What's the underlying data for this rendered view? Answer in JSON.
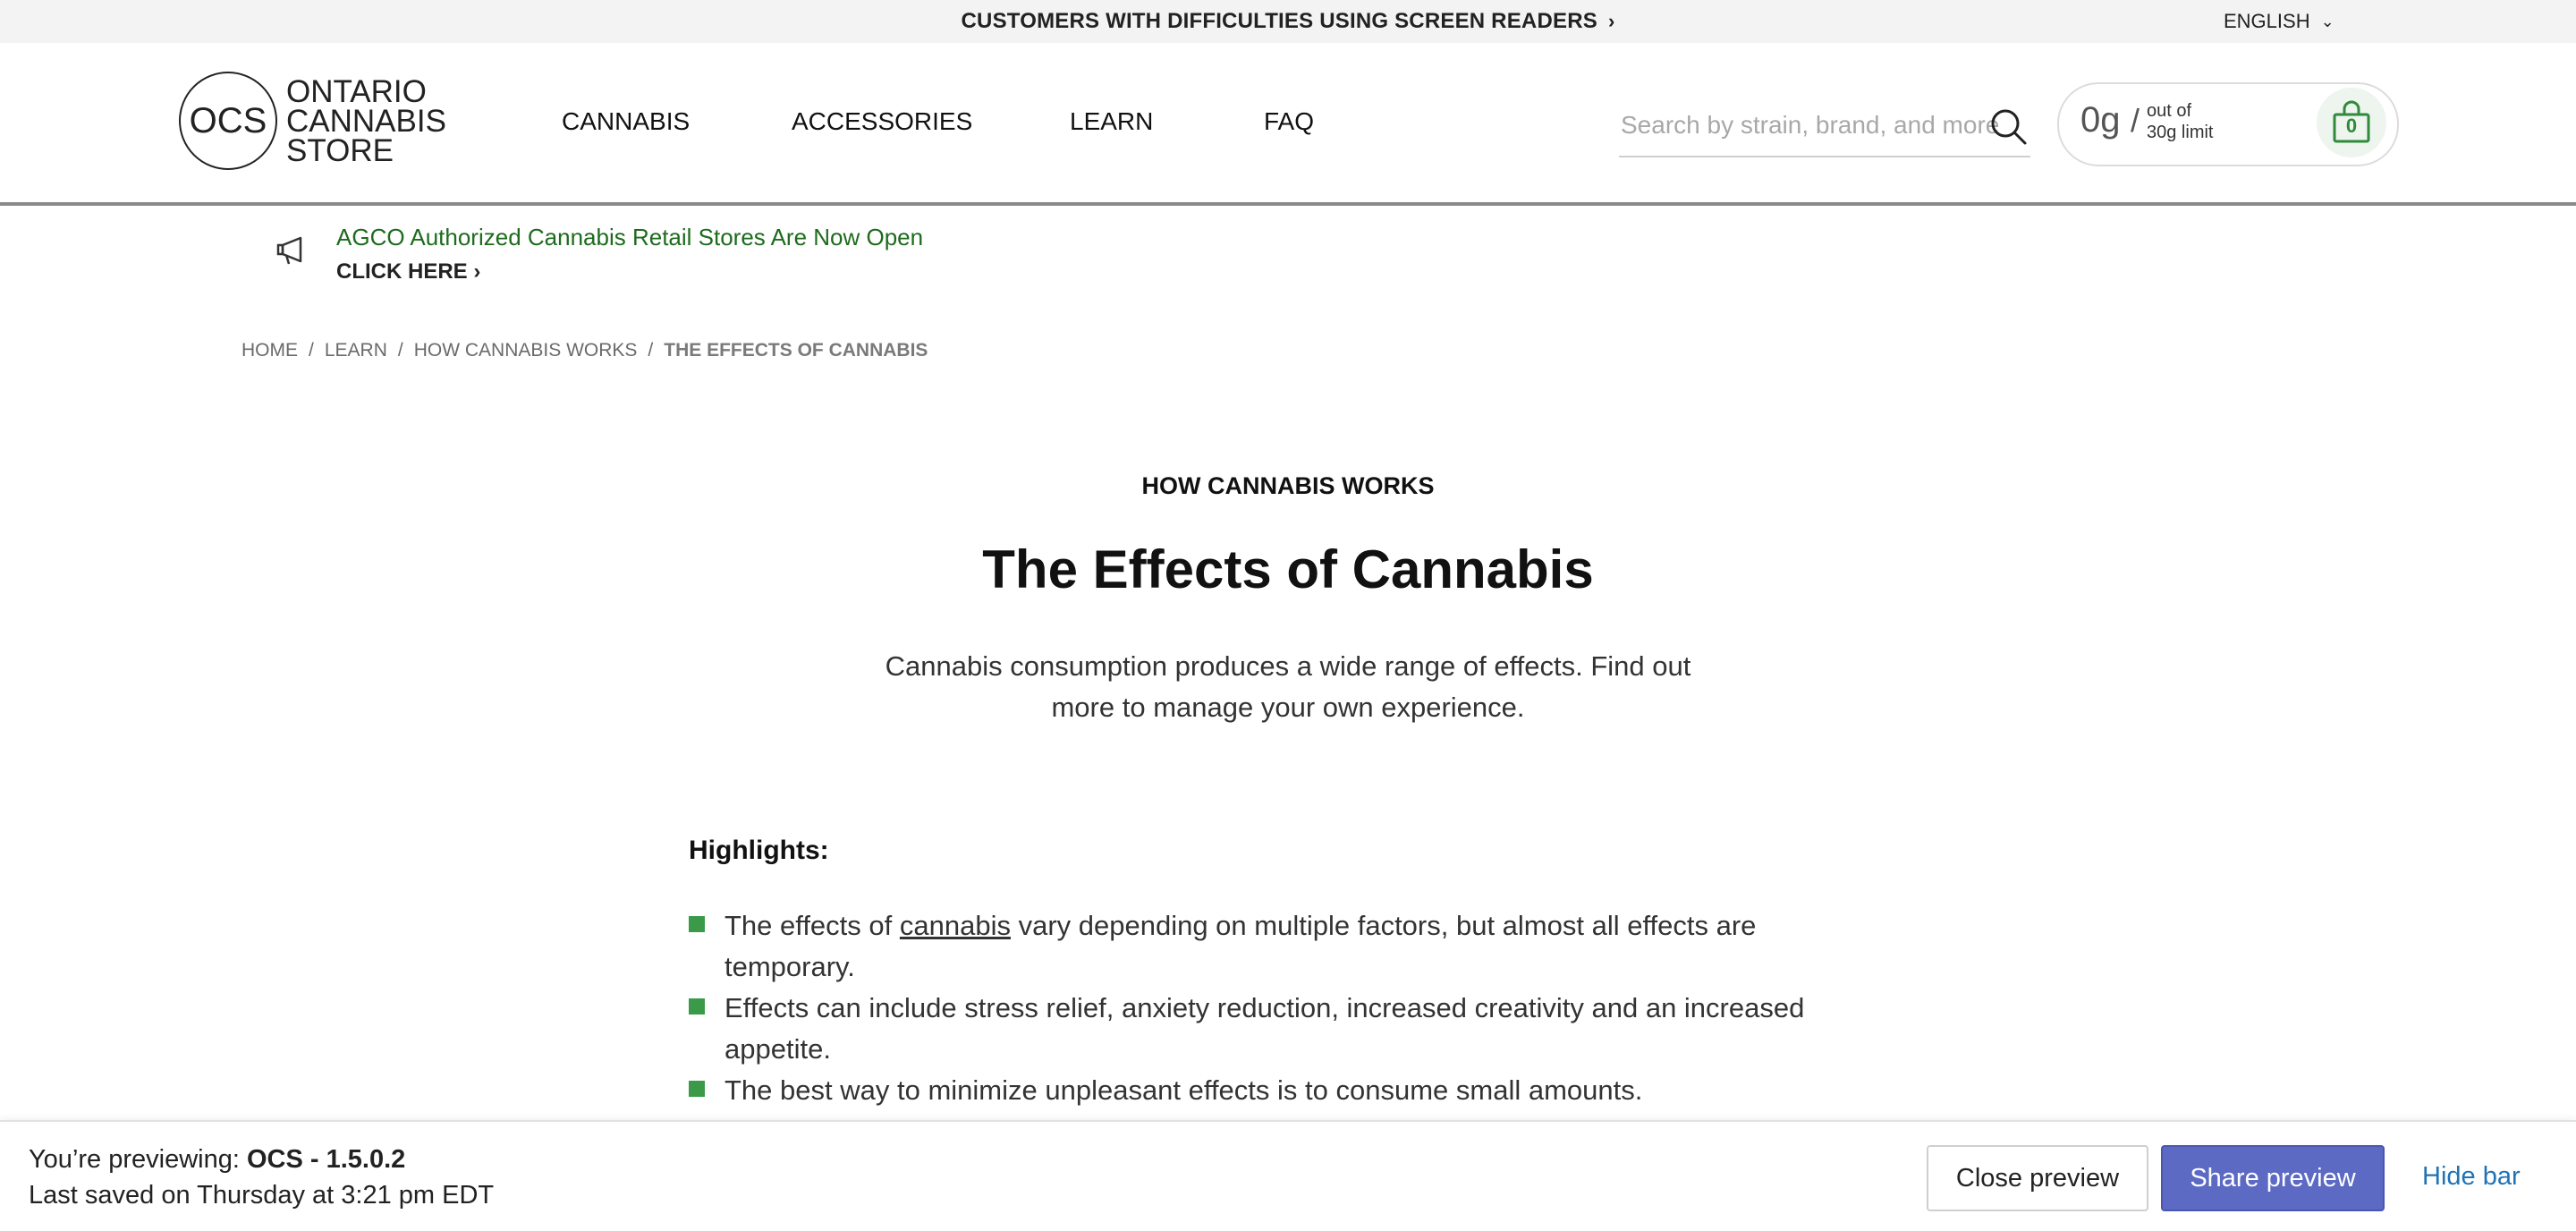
{
  "topbar": {
    "accessibility_link": "CUSTOMERS WITH DIFFICULTIES USING SCREEN READERS",
    "language": "ENGLISH"
  },
  "header": {
    "logo": {
      "mark": "OCS",
      "line1": "ONTARIO",
      "line2": "CANNABIS",
      "line3": "STORE"
    },
    "nav": [
      "CANNABIS",
      "ACCESSORIES",
      "LEARN",
      "FAQ"
    ],
    "search": {
      "placeholder": "Search by strain, brand, and more"
    },
    "cart": {
      "amount": "0g",
      "slash": "/",
      "limit_line1": "out of",
      "limit_line2": "30g limit",
      "count": "0"
    }
  },
  "announcement": {
    "message": "AGCO Authorized Cannabis Retail Stores Are Now Open",
    "cta": "CLICK HERE"
  },
  "breadcrumb": [
    "HOME",
    "LEARN",
    "HOW CANNABIS WORKS",
    "THE EFFECTS OF CANNABIS"
  ],
  "article": {
    "kicker": "HOW CANNABIS WORKS",
    "title": "The Effects of Cannabis",
    "lede": "Cannabis consumption produces a wide range of effects. Find out more to manage your own experience.",
    "highlights_title": "Highlights:",
    "highlights": [
      {
        "before": "The effects of ",
        "link": "cannabis",
        "after": " vary depending on multiple factors, but almost all effects are temporary."
      },
      {
        "text": "Effects can include stress relief, anxiety reduction, increased creativity and an increased appetite."
      },
      {
        "text": "The best way to minimize unpleasant effects is to consume small amounts."
      }
    ]
  },
  "preview_bar": {
    "previewing_prefix": "You’re previewing: ",
    "theme_name": "OCS - 1.5.0.2",
    "saved": "Last saved on Thursday at 3:21 pm EDT",
    "close_label": "Close preview",
    "share_label": "Share preview",
    "hide_label": "Hide bar"
  },
  "colors": {
    "announcement_green": "#1d6b1d",
    "bullet_green": "#3a9a48",
    "share_button": "#5c6ac4",
    "hide_link": "#1f73b7"
  },
  "icons": [
    "chevron-right-icon",
    "chevron-down-icon",
    "search-icon",
    "shopping-bag-icon",
    "megaphone-icon"
  ]
}
